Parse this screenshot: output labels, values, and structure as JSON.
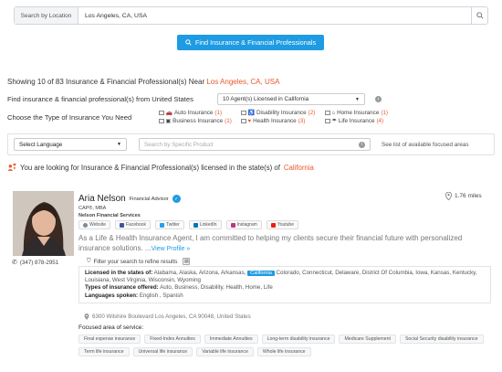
{
  "search": {
    "label": "Search by Location",
    "value": "Los Angeles, CA, USA",
    "icon": "search-icon"
  },
  "find_button": {
    "label": "Find Insurance & Financial Professionals",
    "icon": "search-icon"
  },
  "results": {
    "prefix": "Showing 10 of 83 Insurance & Financial Professional(s) Near",
    "location": "Los Angeles, CA, USA"
  },
  "find_from": {
    "label": "Find insurance & financial professional(s) from United States",
    "select_value": "10 Agent(s) Licensed in California"
  },
  "insurance_types": {
    "label": "Choose the Type of Insurance You Need",
    "items": [
      {
        "label": "Auto Insurance",
        "count": "(1)",
        "icon": "car-icon"
      },
      {
        "label": "Disability Insurance",
        "count": "(2)",
        "icon": "wheelchair-icon"
      },
      {
        "label": "Home Insurance",
        "count": "(1)",
        "icon": "house-icon"
      },
      {
        "label": "Business Insurance",
        "count": "(1)",
        "icon": "briefcase-icon"
      },
      {
        "label": "Health Insurance",
        "count": "(3)",
        "icon": "heart-icon"
      },
      {
        "label": "Life Insurance",
        "count": "(4)",
        "icon": "umbrella-icon"
      }
    ]
  },
  "filters": {
    "language_select": "Select Language",
    "product_placeholder": "Search by Specific Product",
    "focused_link": "See list of available focused areas"
  },
  "looking_for": {
    "prefix": "You are looking for Insurance & Financial Professional(s) licensed in the state(s) of",
    "state": "California"
  },
  "agent": {
    "name": "Aria Nelson",
    "role": "Financial Advisor",
    "credentials": "CAP®, MBA",
    "company": "Nelson Financial Services",
    "distance": "1.76 miles",
    "phone": "(347) 878-2951",
    "socials": [
      {
        "label": "Website",
        "color": "#7a8a9a"
      },
      {
        "label": "Facebook",
        "color": "#3b5998"
      },
      {
        "label": "Twitter",
        "color": "#1da1f2"
      },
      {
        "label": "LinkedIn",
        "color": "#0077b5"
      },
      {
        "label": "Instagram",
        "color": "#c13584"
      },
      {
        "label": "Youtube",
        "color": "#e62117"
      }
    ],
    "about": "As a Life & Health Insurance Agent, I am committed to helping my clients secure their financial future with personalized insurance solutions. ...",
    "view_profile": "View Profile »",
    "filter_tip": "Filter your search to refine results",
    "licensed_label": "Licensed in the states of:",
    "licensed_before": "Alabama, Alaska, Arizona, Arkansas,",
    "licensed_highlight": "California",
    "licensed_after": "Colorado, Connecticut, Delaware, District Of Columbia, Iowa, Kansas, Kentucky, Louisiana, West Virginia, Wisconsin, Wyoming",
    "types_label": "Types of insurance offered:",
    "types_value": "Auto, Business, Disability, Health, Home, Life",
    "languages_label": "Languages spoken:",
    "languages_value": "English , Spanish",
    "address": "6300 Wilshire Boulevard Los Angeles, CA 90048, United States",
    "focus_title": "Focused area of service:",
    "focus_tags": [
      "Final expense insurance",
      "Fixed-Index Annuities",
      "Immediate Annuities",
      "Long-term disability insurance",
      "Medicare Supplement",
      "Social Security disability insurance",
      "Term life insurance",
      "Universal life insurance",
      "Variable life insurance",
      "Whole life insurance"
    ]
  }
}
